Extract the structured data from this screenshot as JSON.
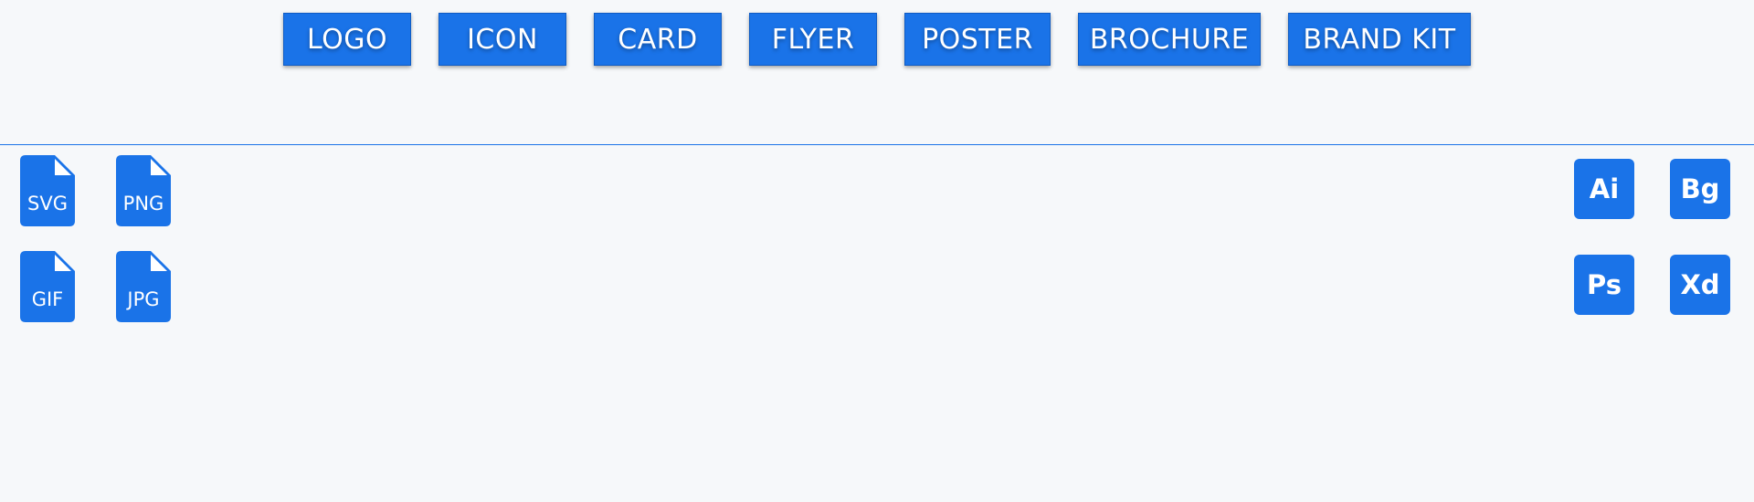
{
  "colors": {
    "accent": "#1a73e8",
    "background": "#f6f8fa",
    "text_on_accent": "#ffffff"
  },
  "tabs": [
    {
      "label": "LOGO"
    },
    {
      "label": "ICON"
    },
    {
      "label": "CARD"
    },
    {
      "label": "FLYER"
    },
    {
      "label": "POSTER"
    },
    {
      "label": "BROCHURE"
    },
    {
      "label": "BRAND KIT"
    }
  ],
  "file_formats": [
    {
      "label": "SVG",
      "icon": "file-svg-icon"
    },
    {
      "label": "PNG",
      "icon": "file-png-icon"
    },
    {
      "label": "GIF",
      "icon": "file-gif-icon"
    },
    {
      "label": "JPG",
      "icon": "file-jpg-icon"
    }
  ],
  "apps": [
    {
      "label": "Ai",
      "icon": "illustrator-icon"
    },
    {
      "label": "Bg",
      "icon": "bg-app-icon"
    },
    {
      "label": "Ps",
      "icon": "photoshop-icon"
    },
    {
      "label": "Xd",
      "icon": "xd-icon"
    }
  ]
}
